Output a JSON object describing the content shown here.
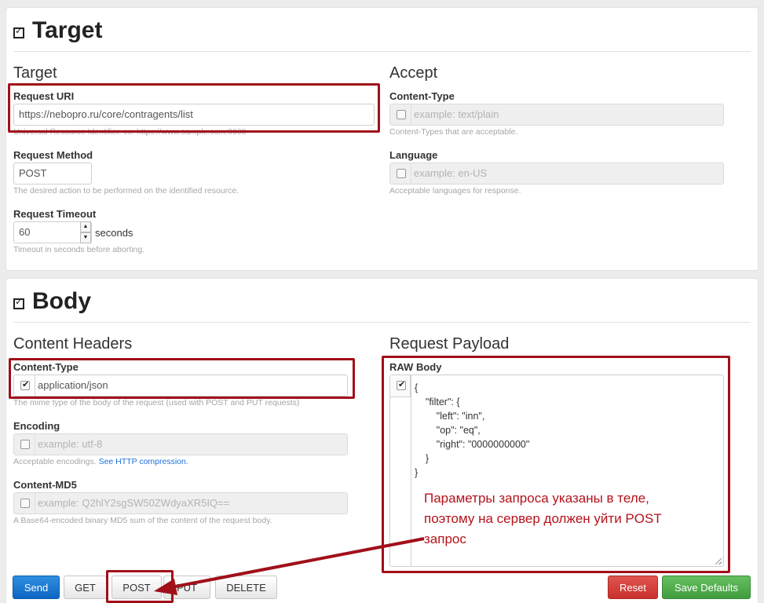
{
  "target_section": {
    "title": "Target",
    "left_heading": "Target",
    "right_heading": "Accept",
    "request_uri": {
      "label": "Request URI",
      "value": "https://nebopro.ru/core/contragents/list",
      "help": "Universal Resource Identifier. ex: https://www.sample.com:9000"
    },
    "request_method": {
      "label": "Request Method",
      "value": "POST",
      "help": "The desired action to be performed on the identified resource."
    },
    "request_timeout": {
      "label": "Request Timeout",
      "value": "60",
      "unit": "seconds",
      "help": "Timeout in seconds before aborting."
    },
    "accept_content_type": {
      "label": "Content-Type",
      "placeholder": "example: text/plain",
      "help": "Content-Types that are acceptable.",
      "checked": false
    },
    "accept_language": {
      "label": "Language",
      "placeholder": "example: en-US",
      "help": "Acceptable languages for response.",
      "checked": false
    }
  },
  "body_section": {
    "title": "Body",
    "left_heading": "Content Headers",
    "right_heading": "Request Payload",
    "content_type": {
      "label": "Content-Type",
      "value": "application/json",
      "help": "The mime type of the body of the request (used with POST and PUT requests)",
      "checked": true
    },
    "encoding": {
      "label": "Encoding",
      "placeholder": "example: utf-8",
      "help_prefix": "Acceptable encodings. ",
      "help_link": "See HTTP compression.",
      "checked": false
    },
    "content_md5": {
      "label": "Content-MD5",
      "placeholder": "example: Q2hlY2sgSW50ZWdyaXR5IQ==",
      "help": "A Base64-encoded binary MD5 sum of the content of the request body.",
      "checked": false
    },
    "raw_body": {
      "label": "RAW Body",
      "checked": true,
      "content": "{\n    \"filter\": {\n        \"left\": \"inn\",\n        \"op\": \"eq\",\n        \"right\": \"0000000000\"\n    }\n}"
    }
  },
  "annotation": {
    "lines": [
      "Параметры запроса указаны в теле,",
      "поэтому на сервер должен уйти POST",
      "запрос"
    ],
    "color": "#b5121b"
  },
  "toolbar": {
    "send": "Send",
    "get": "GET",
    "post": "POST",
    "put": "PUT",
    "delete": "DELETE",
    "reset": "Reset",
    "save_defaults": "Save Defaults"
  },
  "colors": {
    "primary": "#0d66c2",
    "danger": "#c9302c",
    "success": "#419c3d",
    "highlight": "#a10f19"
  },
  "icons": {
    "section_toggle": "checkbox-collapse-icon",
    "arrow": "red-arrow-annotation"
  }
}
